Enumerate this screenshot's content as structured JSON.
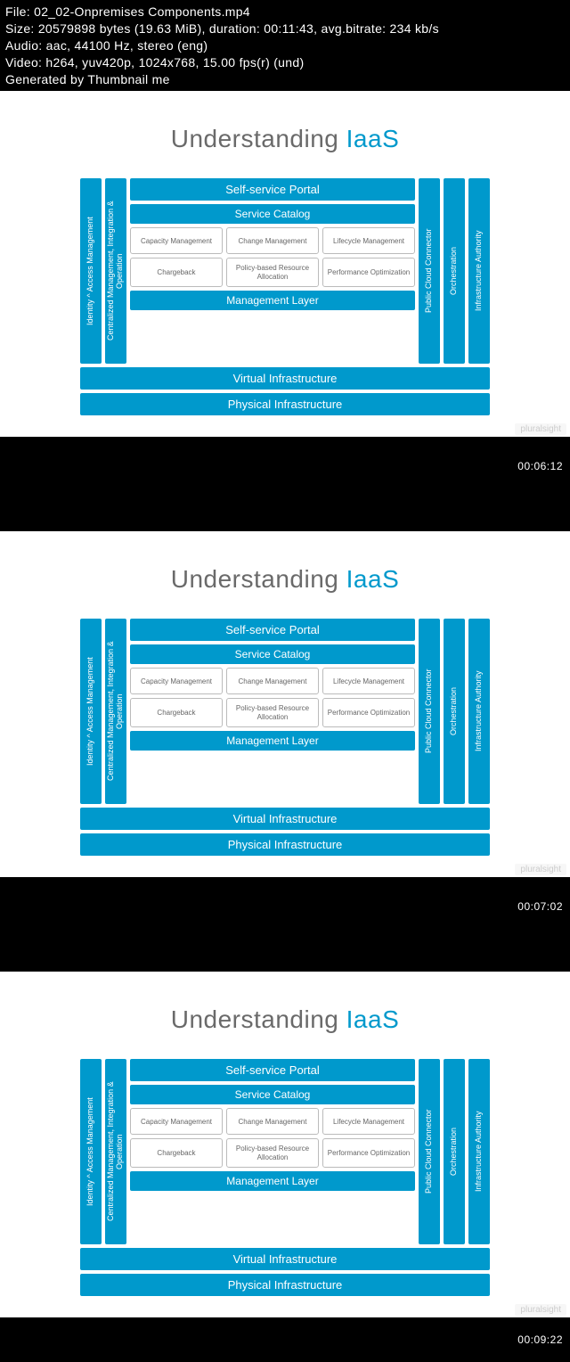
{
  "meta": {
    "line1": "File: 02_02-Onpremises Components.mp4",
    "line2": "Size: 20579898 bytes (19.63 MiB), duration: 00:11:43, avg.bitrate: 234 kb/s",
    "line3": "Audio: aac, 44100 Hz, stereo (eng)",
    "line4": "Video: h264, yuv420p, 1024x768, 15.00 fps(r) (und)",
    "line5": "Generated by Thumbnail me"
  },
  "slide": {
    "title_part1": "Understanding ",
    "title_part2": "IaaS",
    "left": {
      "bar1": "Identity ^ Access Management",
      "bar2": "Centralized Management, Integration & Operation"
    },
    "right": {
      "bar1": "Public Cloud Connector",
      "bar2": "Orchestration",
      "bar3": "Infrastructure Authority"
    },
    "top1": "Self-service Portal",
    "top2": "Service Catalog",
    "grid": {
      "r1c1": "Capacity Management",
      "r1c2": "Change Management",
      "r1c3": "Lifecycle Management",
      "r2c1": "Chargeback",
      "r2c2": "Policy-based Resource Allocation",
      "r2c3": "Performance Optimization"
    },
    "mgmt": "Management Layer",
    "virt": "Virtual Infrastructure",
    "phys": "Physical Infrastructure",
    "watermark": "pluralsight"
  },
  "timestamps": {
    "t1": "00:06:12",
    "t2": "00:07:02",
    "t3": "00:09:22"
  }
}
